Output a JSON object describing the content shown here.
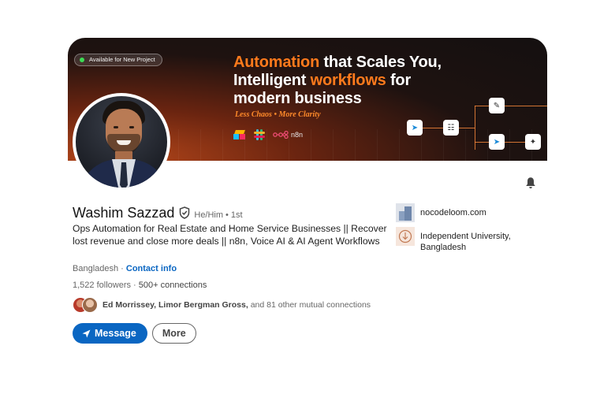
{
  "banner": {
    "badge": "Available for New Project",
    "headline_line1_accent": "Automation",
    "headline_line1_rest": " that Scales You,",
    "headline_line2_start": "Intelligent ",
    "headline_line2_accent": "workflows",
    "headline_line2_end": " for",
    "headline_line3": "modern business",
    "tagline": "Less Chaos • More Clarity",
    "n8n_label": "n8n"
  },
  "profile": {
    "name": "Washim Sazzad",
    "pronouns": "He/Him",
    "separator": "•",
    "degree": "1st",
    "headline": "Ops Automation for Real Estate and Home Service Businesses || Recover lost revenue and close more deals || n8n, Voice AI & AI Agent Workflows",
    "location": "Bangladesh",
    "location_sep": " · ",
    "contact_link": "Contact info",
    "followers": "1,522 followers",
    "stats_sep": " · ",
    "connections": "500+ connections",
    "mutual_names": "Ed Morrissey, Limor Bergman Gross,",
    "mutual_rest": " and 81 other mutual connections"
  },
  "actions": {
    "message_label": "Message",
    "more_label": "More"
  },
  "sidebar": {
    "items": [
      {
        "label": "nocodeloom.com"
      },
      {
        "label": "Independent University, Bangladesh"
      }
    ]
  },
  "colors": {
    "accent": "#0a66c2",
    "banner_orange": "#ff7a1c",
    "available_dot": "#3ddc55"
  }
}
